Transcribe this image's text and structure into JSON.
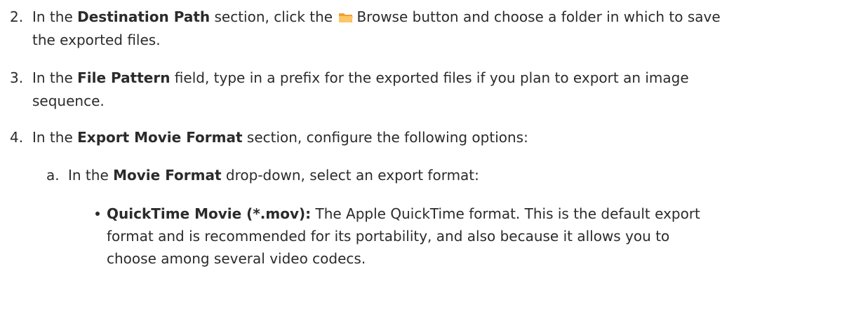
{
  "steps": {
    "s2": {
      "num": "2.",
      "t1": "In the ",
      "b1": "Destination Path",
      "t2": " section, click the ",
      "t3": "Browse button and choose a folder in which to save",
      "t4": "the exported files."
    },
    "s3": {
      "num": "3.",
      "t1": "In the ",
      "b1": "File Pattern",
      "t2": " field, type in a prefix for the exported files if you plan to export an image",
      "t3": "sequence."
    },
    "s4": {
      "num": "4.",
      "t1": "In the ",
      "b1": "Export Movie Format",
      "t2": " section, configure the following options:"
    },
    "s4a": {
      "num": "a.",
      "t1": "In the ",
      "b1": "Movie Format",
      "t2": " drop-down, select an export format:"
    },
    "bullet1": {
      "b1": "QuickTime Movie (*.mov):",
      "t1": " The Apple QuickTime format. This is the default export",
      "t2": "format and is recommended for its portability, and also because it allows you to",
      "t3": "choose among several video codecs."
    }
  },
  "icons": {
    "browse": "folder-icon",
    "folder_colors": [
      "#f5a623",
      "#fcd27a"
    ]
  }
}
